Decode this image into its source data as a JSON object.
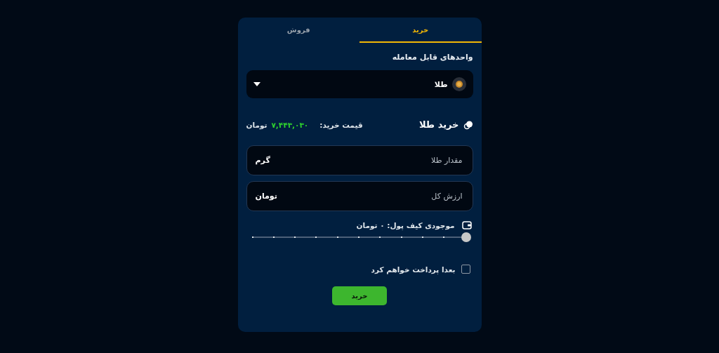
{
  "tabs": [
    {
      "label": "خرید",
      "selected": true
    },
    {
      "label": "فروش",
      "selected": false
    }
  ],
  "units_label": "واحدهای قابل معامله",
  "unit_select": {
    "value": "طلا"
  },
  "buy_title": "خرید طلا",
  "price": {
    "label": "قیمت خرید:",
    "amount": "۷,۴۴۳,۰۳۰",
    "currency": "تومان"
  },
  "fields": [
    {
      "placeholder": "مقدار طلا",
      "unit": "گرم"
    },
    {
      "placeholder": "ارزش کل",
      "unit": "تومان"
    }
  ],
  "wallet": {
    "text": "موجودی کیف پول: ۰ تومان"
  },
  "pay_later": {
    "label": "بعدا پرداخت خواهم کرد",
    "checked": false
  },
  "submit": "خرید"
}
